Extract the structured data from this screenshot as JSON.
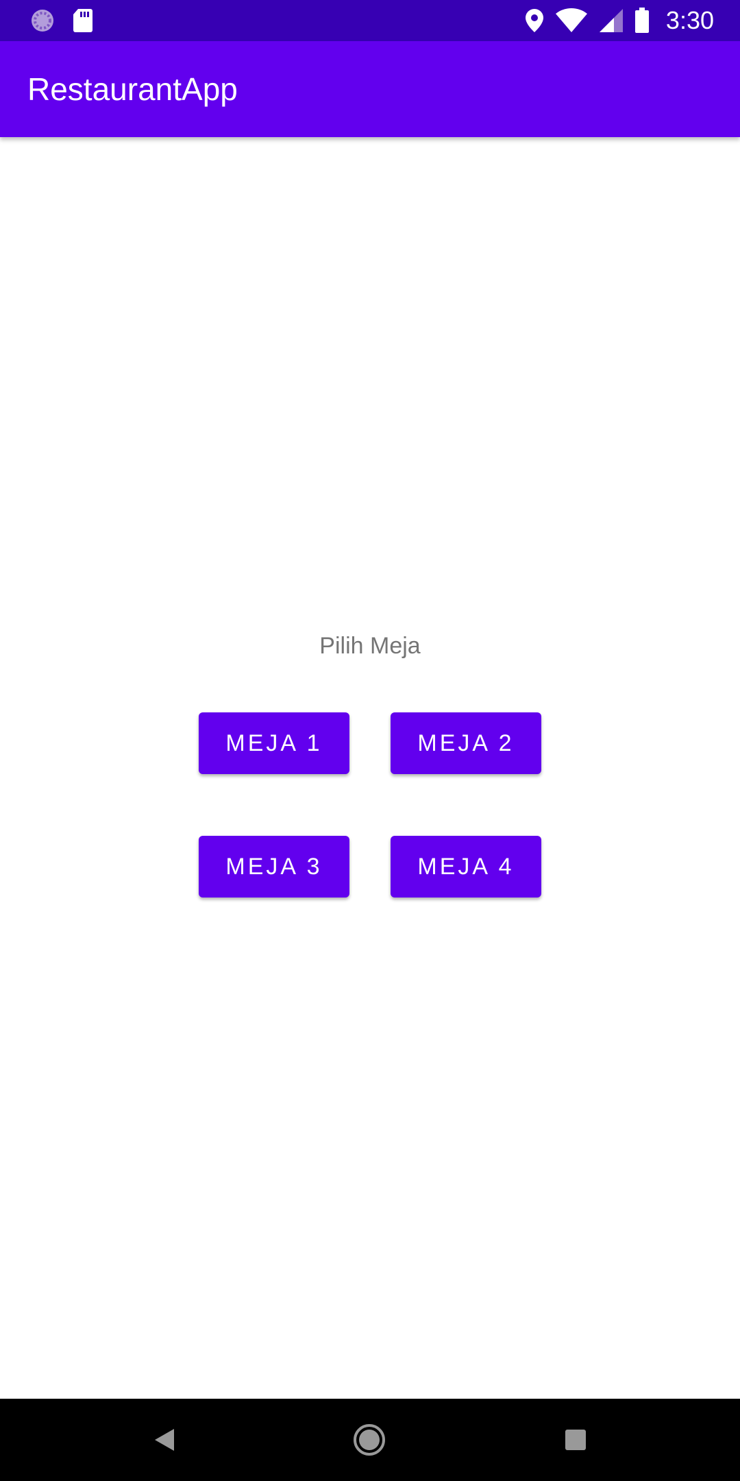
{
  "status_bar": {
    "time": "3:30",
    "left_icons": [
      "sync-icon",
      "sd-card-icon"
    ],
    "right_icons": [
      "location-icon",
      "wifi-icon",
      "signal-icon",
      "battery-icon"
    ]
  },
  "app_bar": {
    "title": "RestaurantApp"
  },
  "main": {
    "prompt": "Pilih Meja",
    "buttons": [
      {
        "label": "MEJA 1"
      },
      {
        "label": "MEJA 2"
      },
      {
        "label": "MEJA 3"
      },
      {
        "label": "MEJA 4"
      }
    ]
  },
  "nav_bar": {
    "icons": [
      "back-icon",
      "home-icon",
      "recents-icon"
    ]
  },
  "colors": {
    "status_bar": "#3700b3",
    "primary": "#6200ee",
    "label_text": "#757575",
    "nav_bar": "#000000"
  }
}
